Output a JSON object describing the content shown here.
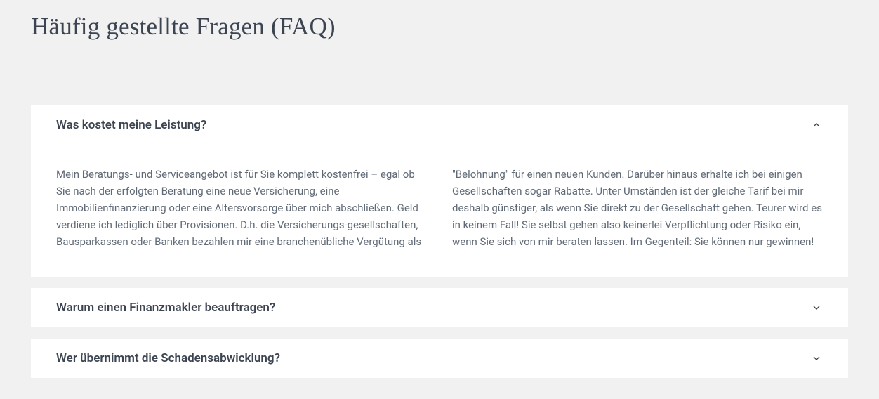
{
  "title": "Häufig gestellte Fragen (FAQ)",
  "faq": [
    {
      "question": "Was kostet meine Leistung?",
      "expanded": true,
      "answer": "Mein Beratungs- und Serviceangebot ist für Sie komplett kostenfrei – egal ob Sie nach der erfolgten Beratung eine neue Versicherung, eine Immobilienfinanzierung oder eine Altersvorsorge über mich abschließen. Geld verdiene ich lediglich über Provisionen. D.h. die Versicherungs-gesellschaften, Bausparkassen oder Banken bezahlen mir eine branchenübliche Vergütung als \"Belohnung\" für einen neuen Kunden. Darüber hinaus erhalte ich bei einigen Gesellschaften sogar Rabatte. Unter Umständen ist der gleiche Tarif bei mir deshalb günstiger, als wenn Sie direkt zu der Gesellschaft gehen. Teurer wird es in keinem Fall! Sie selbst gehen also keinerlei Verpflichtung oder Risiko ein, wenn Sie sich von mir beraten lassen. Im Gegenteil: Sie können nur gewinnen!"
    },
    {
      "question": "Warum einen Finanzmakler beauftragen?",
      "expanded": false
    },
    {
      "question": "Wer übernimmt die Schadensabwicklung?",
      "expanded": false
    }
  ]
}
